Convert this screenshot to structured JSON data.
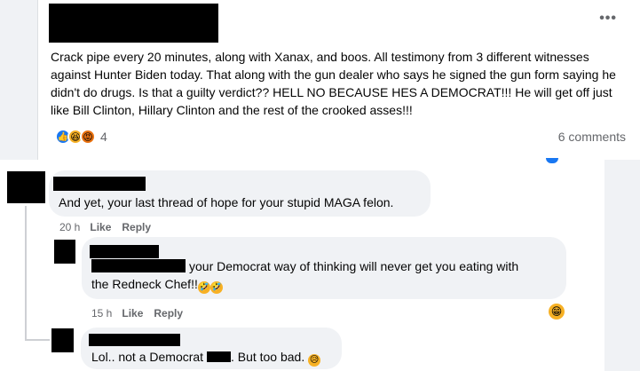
{
  "post": {
    "menu": "•••",
    "body": "Crack pipe every 20 minutes, along with Xanax, and boos. All testimony from 3 different witnesses against Hunter Biden today. That along with the gun dealer who says he signed the gun form saying he didn't do drugs. Is that a guilty verdict?? HELL NO BECAUSE HES A DEMOCRAT!!! He will get off just like Bill Clinton, Hillary Clinton and the rest of the crooked asses!!!",
    "reaction_icons": [
      "like-icon",
      "haha-icon",
      "angry-icon"
    ],
    "reaction_count": "4",
    "comment_count": "6 comments"
  },
  "comments": [
    {
      "text": "And yet, your last thread of hope for your stupid MAGA felon.",
      "time": "20 h",
      "like_label": "Like",
      "reply_label": "Reply"
    },
    {
      "text_after_redaction": "your Democrat way of thinking will never get you eating with",
      "text_line2": "the Redneck Chef!!",
      "inline_emojis": [
        "🤣",
        "🤣"
      ],
      "time": "15 h",
      "like_label": "Like",
      "reply_label": "Reply",
      "reaction_badge": "😁"
    },
    {
      "text_part1": "Lol.. not a Democrat",
      "text_part2": ". But too bad.",
      "inline_emoji": "😥"
    }
  ],
  "colors": {
    "background": "#f0f2f5",
    "card": "#ffffff",
    "secondary_text": "#65676b",
    "like_blue": "#1877f2"
  }
}
